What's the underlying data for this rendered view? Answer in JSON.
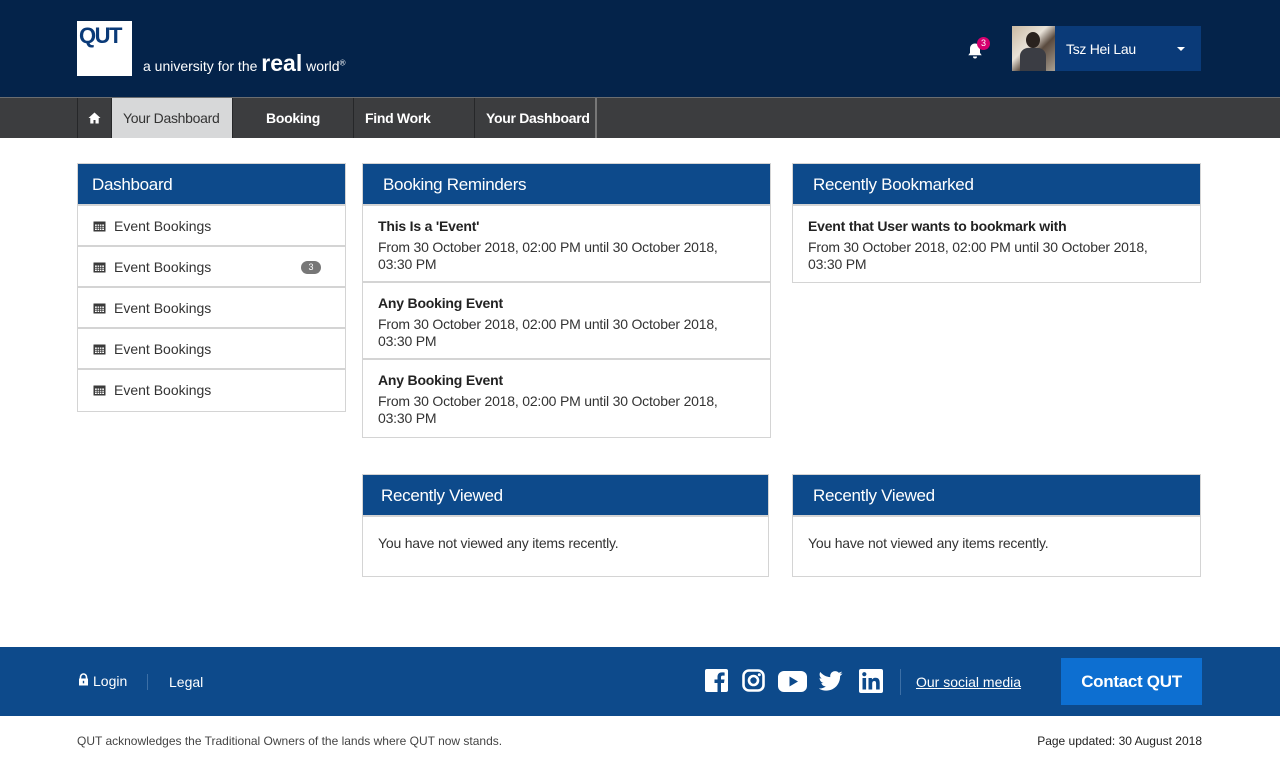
{
  "header": {
    "logo_text": "QUT",
    "tagline_small": "a university for the",
    "tagline_big": "real",
    "tagline_world": "world",
    "tagline_reg": "®",
    "notifications_count": "3",
    "user_name": "Tsz Hei Lau"
  },
  "nav": {
    "items": [
      {
        "label": "Your Dashboard"
      },
      {
        "label": "Booking"
      },
      {
        "label": "Find Work"
      },
      {
        "label": "Your Dashboard"
      }
    ]
  },
  "sidebar": {
    "title": "Dashboard",
    "items": [
      {
        "label": "Event Bookings",
        "badge": ""
      },
      {
        "label": "Event Bookings",
        "badge": "3"
      },
      {
        "label": "Event Bookings",
        "badge": ""
      },
      {
        "label": "Event Bookings",
        "badge": ""
      },
      {
        "label": "Event Bookings",
        "badge": ""
      }
    ]
  },
  "reminders": {
    "title": "Booking Reminders",
    "items": [
      {
        "title": "This Is a 'Event'",
        "text": "From 30 October 2018, 02:00 PM until 30 October 2018, 03:30 PM"
      },
      {
        "title": "Any Booking Event",
        "text": "From 30 October 2018, 02:00 PM until 30 October 2018, 03:30 PM"
      },
      {
        "title": "Any Booking Event",
        "text": "From 30 October 2018, 02:00 PM until 30 October 2018, 03:30 PM"
      }
    ]
  },
  "bookmarked": {
    "title": "Recently Bookmarked",
    "items": [
      {
        "title": "Event that User wants to bookmark with",
        "text": "From 30 October 2018, 02:00 PM until 30 October 2018, 03:30 PM"
      }
    ]
  },
  "viewed_left": {
    "title": "Recently Viewed",
    "empty_text": "You have not viewed any items recently."
  },
  "viewed_right": {
    "title": "Recently Viewed",
    "empty_text": "You have not viewed any items recently."
  },
  "footer": {
    "login": "Login",
    "legal": "Legal",
    "social_link": "Our social media",
    "contact": "Contact QUT",
    "acknowledgement": "QUT acknowledges the Traditional Owners of the lands where QUT now stands.",
    "updated": "Page updated: 30 August 2018"
  },
  "icons": [
    "home-icon",
    "bell-icon",
    "calendar-icon",
    "lock-icon",
    "facebook-icon",
    "instagram-icon",
    "youtube-icon",
    "twitter-icon",
    "linkedin-icon"
  ],
  "colors": {
    "header_bg": "#04234a",
    "accent_blue": "#0d4a8b",
    "contact_btn": "#0d6fd1",
    "nav_bg": "#3c3d3f",
    "badge_pink": "#d6006e"
  }
}
